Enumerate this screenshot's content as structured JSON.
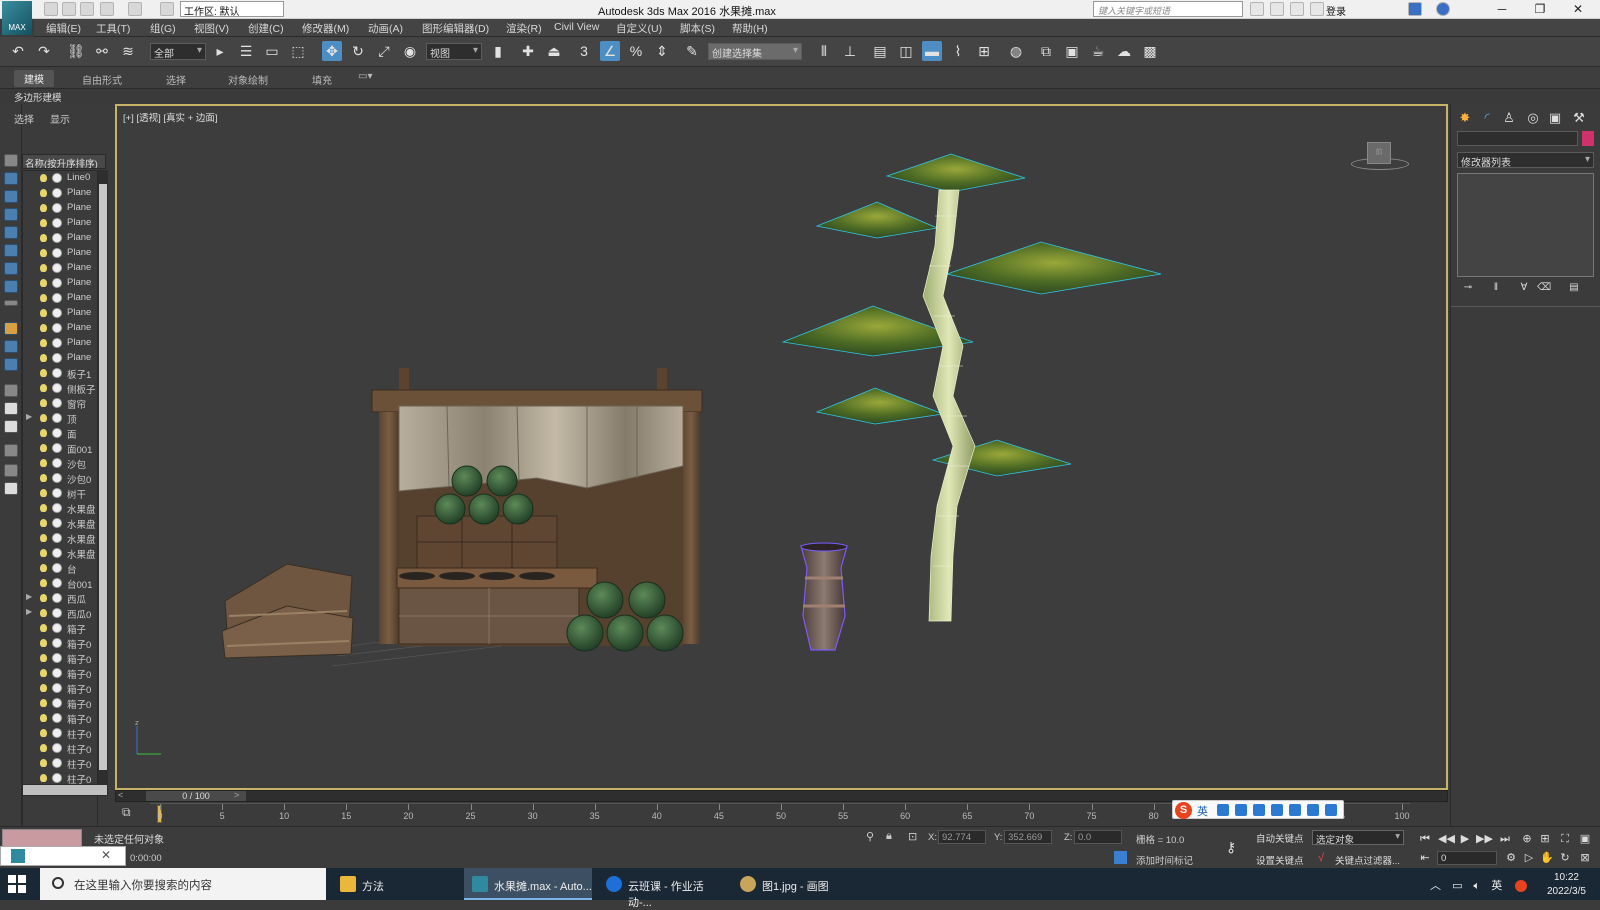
{
  "app": {
    "title": "Autodesk 3ds Max 2016    水果摊.max",
    "logo_text": "MAX",
    "workspace": "工作区: 默认",
    "search_placeholder": "键入关键字或短语",
    "login": "登录"
  },
  "menu": [
    "编辑(E)",
    "工具(T)",
    "组(G)",
    "视图(V)",
    "创建(C)",
    "修改器(M)",
    "动画(A)",
    "图形编辑器(D)",
    "渲染(R)",
    "Civil View",
    "自定义(U)",
    "脚本(S)",
    "帮助(H)"
  ],
  "toolbar": {
    "filter": "全部",
    "ref_coord": "视图",
    "snap_3": "3",
    "named_selection": "创建选择集"
  },
  "ribbon": {
    "tabs": [
      "建模",
      "自由形式",
      "选择",
      "对象绘制",
      "填充"
    ],
    "active": "建模",
    "sub_label": "多边形建模"
  },
  "explorer": {
    "tabs": [
      "选择",
      "显示"
    ],
    "sort_header": "名称(按升序排序)",
    "objects": [
      {
        "name": "Line0"
      },
      {
        "name": "Plane"
      },
      {
        "name": "Plane"
      },
      {
        "name": "Plane"
      },
      {
        "name": "Plane"
      },
      {
        "name": "Plane"
      },
      {
        "name": "Plane"
      },
      {
        "name": "Plane"
      },
      {
        "name": "Plane"
      },
      {
        "name": "Plane"
      },
      {
        "name": "Plane"
      },
      {
        "name": "Plane"
      },
      {
        "name": "Plane"
      },
      {
        "name": "板子1"
      },
      {
        "name": "侧板子"
      },
      {
        "name": "窗帘"
      },
      {
        "name": "顶",
        "expand": true
      },
      {
        "name": "面"
      },
      {
        "name": "面001"
      },
      {
        "name": "沙包"
      },
      {
        "name": "沙包0"
      },
      {
        "name": "树干"
      },
      {
        "name": "水果盘"
      },
      {
        "name": "水果盘"
      },
      {
        "name": "水果盘"
      },
      {
        "name": "水果盘"
      },
      {
        "name": "台"
      },
      {
        "name": "台001"
      },
      {
        "name": "西瓜",
        "expand": true
      },
      {
        "name": "西瓜0",
        "expand": true
      },
      {
        "name": "箱子"
      },
      {
        "name": "箱子0"
      },
      {
        "name": "箱子0"
      },
      {
        "name": "箱子0"
      },
      {
        "name": "箱子0"
      },
      {
        "name": "箱子0"
      },
      {
        "name": "箱子0"
      },
      {
        "name": "柱子0"
      },
      {
        "name": "柱子0"
      },
      {
        "name": "柱子0"
      },
      {
        "name": "柱子0"
      }
    ]
  },
  "viewport": {
    "label": "[+] [透视] [真实 + 边面]",
    "cube_label": "前"
  },
  "command_panel": {
    "modifier_list": "修改器列表"
  },
  "timeline": {
    "frame_counter": "0 / 100",
    "ticks": [
      0,
      5,
      10,
      15,
      20,
      25,
      30,
      35,
      40,
      45,
      50,
      55,
      60,
      65,
      70,
      75,
      80,
      85,
      90,
      95,
      100
    ]
  },
  "status": {
    "message": "未选定任何对象",
    "time": "0:00:00",
    "x_label": "X:",
    "x_value": "92.774",
    "y_label": "Y:",
    "y_value": "352.669",
    "z_label": "Z:",
    "z_value": "0.0",
    "grid": "栅格 = 10.0",
    "add_time_tag": "添加时间标记",
    "auto_key": "自动关键点",
    "set_key": "设置关键点",
    "selected_object": "选定对象",
    "key_filter": "关键点过滤器...",
    "frame": "0"
  },
  "ime": {
    "lang": "英"
  },
  "taskbar": {
    "search_text": "在这里输入你要搜索的内容",
    "tasks": [
      {
        "label": "方法",
        "color": "#e9b73a"
      },
      {
        "label": "水果摊.max - Auto...",
        "color": "#2f8aa0"
      },
      {
        "label": "云班课 - 作业活动-...",
        "color": "#1f6fd8"
      },
      {
        "label": "图1.jpg - 画图",
        "color": "#c8a55a"
      }
    ],
    "tray_lang": "英",
    "clock_time": "10:22",
    "clock_date": "2022/3/5"
  }
}
